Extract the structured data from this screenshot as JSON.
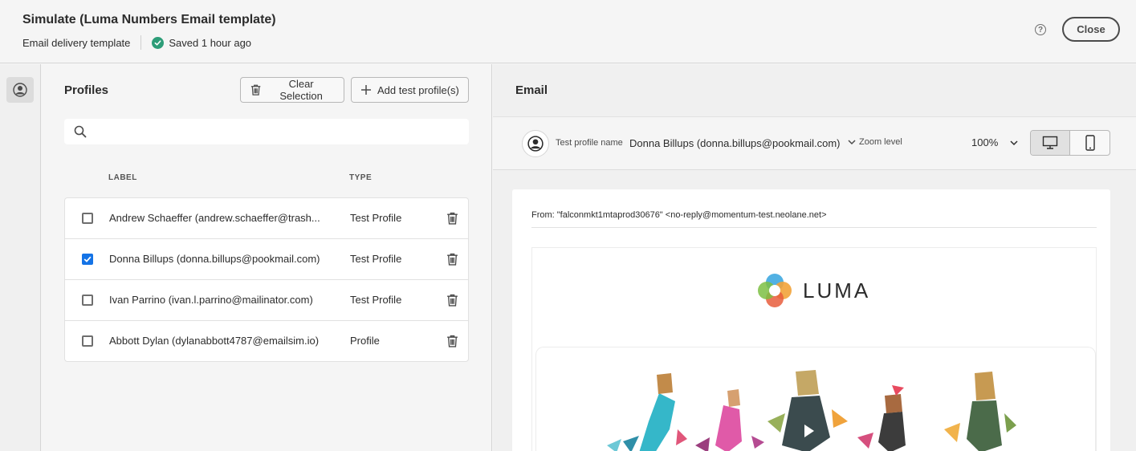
{
  "header": {
    "title": "Simulate (Luma Numbers Email template)",
    "subtitle": "Email delivery template",
    "saved_status": "Saved 1 hour ago",
    "close_label": "Close",
    "help_glyph": "?"
  },
  "profiles": {
    "title": "Profiles",
    "clear_selection_label": "Clear Selection",
    "add_test_profile_label": "Add test profile(s)",
    "search": {
      "value": "",
      "placeholder": ""
    },
    "columns": {
      "label": "LABEL",
      "type": "TYPE"
    },
    "rows": [
      {
        "label": "Andrew Schaeffer (andrew.schaeffer@trash...",
        "type": "Test Profile",
        "checked": false
      },
      {
        "label": "Donna Billups (donna.billups@pookmail.com)",
        "type": "Test Profile",
        "checked": true
      },
      {
        "label": "Ivan Parrino (ivan.l.parrino@mailinator.com)",
        "type": "Test Profile",
        "checked": false
      },
      {
        "label": "Abbott Dylan (dylanabbott4787@emailsim.io)",
        "type": "Profile",
        "checked": false
      }
    ]
  },
  "email": {
    "title": "Email",
    "test_profile_label": "Test profile name",
    "test_profile_value": "Donna Billups (donna.billups@pookmail.com)",
    "zoom_label": "Zoom level",
    "zoom_value": "100%",
    "from_line": "From: \"falconmkt1mtaprod30676\" <no-reply@momentum-test.neolane.net>",
    "logo_text": "LUMA"
  },
  "icons": {
    "rail": "user-circle-icon",
    "trash": "trash-icon",
    "add": "plus-icon",
    "search": "search-icon",
    "desktop": "desktop-icon",
    "mobile": "mobile-icon",
    "check": "check-circle-icon",
    "chevron": "chevron-down-icon"
  },
  "colors": {
    "checkbox_checked": "#1473e6",
    "saved_green": "#2d9d78",
    "panel_bg": "#f5f5f5"
  }
}
